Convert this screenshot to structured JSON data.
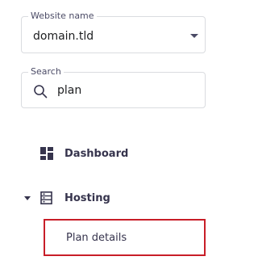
{
  "website_select": {
    "label": "Website name",
    "value": "domain.tld"
  },
  "search": {
    "label": "Search",
    "value": "plan"
  },
  "nav": {
    "dashboard": {
      "label": "Dashboard",
      "icon": "dashboard-grid-icon"
    },
    "hosting": {
      "label": "Hosting",
      "icon": "server-icon",
      "expanded": true,
      "children": [
        {
          "label": "Plan details",
          "highlighted": true
        }
      ]
    }
  },
  "colors": {
    "text": "#36344d",
    "border": "#dadce0",
    "highlight_border": "#c81e28"
  }
}
